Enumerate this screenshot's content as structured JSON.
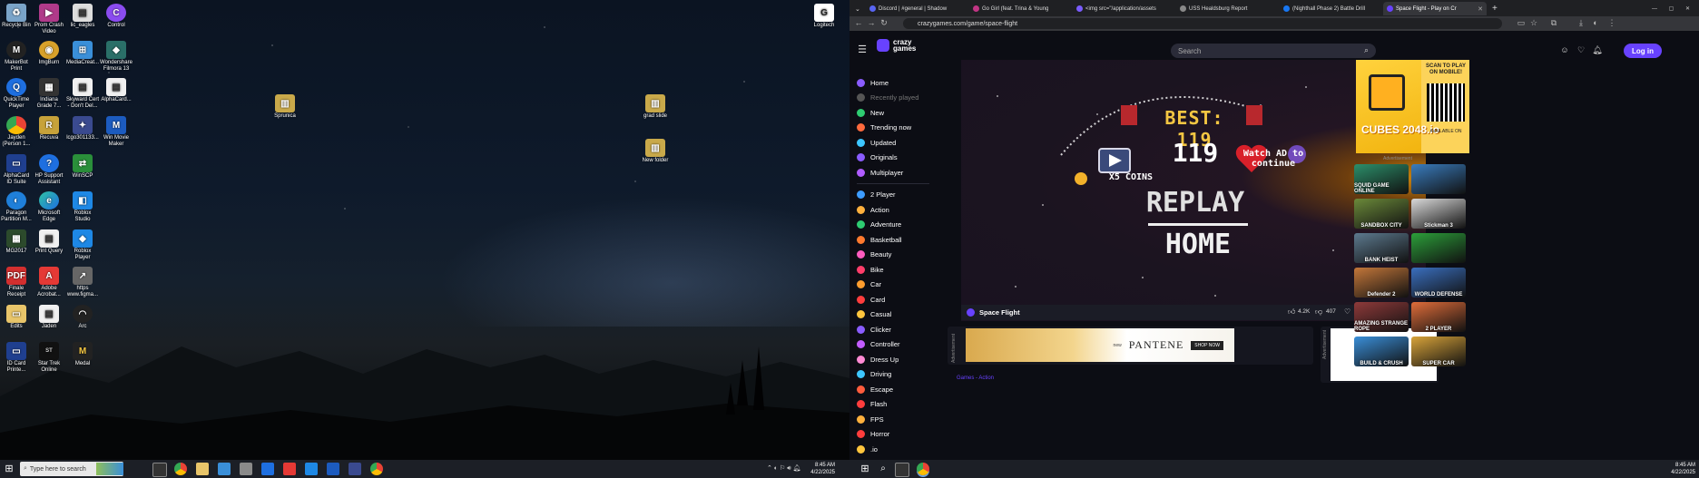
{
  "desktop": {
    "icons": [
      {
        "label": "Recycle Bin",
        "name": "recycle-bin-icon"
      },
      {
        "label": "Prom Crash Video",
        "name": "video-file-icon"
      },
      {
        "label": "lic_eagles",
        "name": "image-file-icon"
      },
      {
        "label": "Control",
        "name": "app-icon"
      },
      {
        "label": "MakerBot Print",
        "name": "makerbot-icon"
      },
      {
        "label": "ImgBurn",
        "name": "disc-icon"
      },
      {
        "label": "MediaCreat...",
        "name": "media-creation-icon"
      },
      {
        "label": "Wondershare Filmora 13",
        "name": "filmora-icon"
      },
      {
        "label": "QuickTime Player",
        "name": "quicktime-icon"
      },
      {
        "label": "Indiana Grade 7...",
        "name": "document-icon"
      },
      {
        "label": "Skyward Cert - Don't Del...",
        "name": "document-icon"
      },
      {
        "label": "AlphaCard...",
        "name": "document-icon"
      },
      {
        "label": "Jayden (Person 1...",
        "name": "chrome-profile-icon"
      },
      {
        "label": "Recuva",
        "name": "recuva-icon"
      },
      {
        "label": "lcgo301133...",
        "name": "image-file-icon"
      },
      {
        "label": "Win Movie Maker",
        "name": "movie-maker-icon"
      },
      {
        "label": "AlphaCard ID Suite",
        "name": "alphacard-icon"
      },
      {
        "label": "HP Support Assistant",
        "name": "hp-support-icon"
      },
      {
        "label": "WinSCP",
        "name": "winscp-icon"
      },
      {
        "label": "Paragon Partition M...",
        "name": "paragon-icon"
      },
      {
        "label": "Microsoft Edge",
        "name": "edge-icon"
      },
      {
        "label": "Roblox Studio",
        "name": "roblox-studio-icon"
      },
      {
        "label": "MG2017",
        "name": "app-icon"
      },
      {
        "label": "Print Query",
        "name": "document-icon"
      },
      {
        "label": "Roblox Player",
        "name": "roblox-icon"
      },
      {
        "label": "Finale Receipt",
        "name": "pdf-icon"
      },
      {
        "label": "Adobe Acrobat...",
        "name": "acrobat-icon"
      },
      {
        "label": "https www.figma...",
        "name": "shortcut-icon"
      },
      {
        "label": "Edits",
        "name": "folder-icon"
      },
      {
        "label": "Jaden",
        "name": "document-icon"
      },
      {
        "label": "Arc",
        "name": "arc-icon"
      },
      {
        "label": "ID Card Printe...",
        "name": "id-card-icon"
      },
      {
        "label": "Star Trek Online",
        "name": "star-trek-icon"
      },
      {
        "label": "Medal",
        "name": "medal-icon"
      },
      {
        "label": "Sprunica",
        "name": "archive-icon"
      },
      {
        "label": "grad slide",
        "name": "archive-icon"
      },
      {
        "label": "New folder",
        "name": "archive-icon"
      },
      {
        "label": "Logitech",
        "name": "logitech-icon"
      }
    ]
  },
  "taskbar": {
    "search_placeholder": "Type here to search",
    "time_left": "8:45 AM",
    "date_left": "4/22/2025",
    "time_right": "8:45 AM",
    "date_right": "4/22/2025"
  },
  "browser": {
    "tabs": [
      {
        "label": "Discord | #general | Shadow",
        "color": "#5865f2"
      },
      {
        "label": "Go Girl (feat. Trina & Young",
        "color": "#c13584"
      },
      {
        "label": "<img src=\"/application/assets",
        "color": "#7a5cff"
      },
      {
        "label": "USS Healdsburg Report",
        "color": "#888888"
      },
      {
        "label": "(Nighthall Phase 2) Battle Drill",
        "color": "#1877f2"
      },
      {
        "label": "Space Flight - Play on Cr",
        "color": "#6842ff"
      }
    ],
    "url": "crazygames.com/game/space-flight"
  },
  "crazygames": {
    "logo_top": "crazy",
    "logo_bottom": "games",
    "search_placeholder": "Search",
    "login_label": "Log in",
    "sidebar": [
      {
        "label": "Home",
        "color": "#8a5cff"
      },
      {
        "label": "Recently played",
        "color": "#555555",
        "dim": true
      },
      {
        "label": "New",
        "color": "#2ecc71"
      },
      {
        "label": "Trending now",
        "color": "#ff6a3d"
      },
      {
        "label": "Updated",
        "color": "#3dc6ff"
      },
      {
        "label": "Originals",
        "color": "#8a5cff"
      },
      {
        "label": "Multiplayer",
        "color": "#b05cff"
      },
      {
        "label": "2 Player",
        "color": "#3d9cff"
      },
      {
        "label": "Action",
        "color": "#ffb03d"
      },
      {
        "label": "Adventure",
        "color": "#2ecc71"
      },
      {
        "label": "Basketball",
        "color": "#ff7a2e"
      },
      {
        "label": "Beauty",
        "color": "#ff5cbf"
      },
      {
        "label": "Bike",
        "color": "#ff3d6a"
      },
      {
        "label": "Car",
        "color": "#ff9d2e"
      },
      {
        "label": "Card",
        "color": "#ff3d3d"
      },
      {
        "label": "Casual",
        "color": "#ffc53d"
      },
      {
        "label": "Clicker",
        "color": "#8a5cff"
      },
      {
        "label": "Controller",
        "color": "#c25cff"
      },
      {
        "label": "Dress Up",
        "color": "#ff8ad4"
      },
      {
        "label": "Driving",
        "color": "#3dc6ff"
      },
      {
        "label": "Escape",
        "color": "#ff5c3d"
      },
      {
        "label": "Flash",
        "color": "#ff3d3d"
      },
      {
        "label": "FPS",
        "color": "#ffb03d"
      },
      {
        "label": "Horror",
        "color": "#ff3d3d"
      },
      {
        ".io_label": "",
        "label": ".io",
        "color": "#ffc53d"
      }
    ],
    "game": {
      "best": "BEST: 119",
      "score": "119",
      "coins": "X5 COINS",
      "watch_ad": "Watch AD to continue",
      "replay": "REPLAY",
      "home": "HOME",
      "title": "Space Flight",
      "likes": "4.2K",
      "dislikes": "407"
    },
    "ad_label": "Advertisement",
    "ad_brand": "PANTENE",
    "ad_new": "new",
    "ad_cta": "SHOP NOW",
    "promo": {
      "game": "CUBES 2048.io",
      "scan": "SCAN TO PLAY ON MOBILE!",
      "available": "AVAILABLE ON"
    },
    "thumbs": [
      {
        "label": "SQUID GAME ONLINE",
        "color": "#2c8f6a"
      },
      {
        "label": "",
        "color": "#3a7dbf"
      },
      {
        "label": "SANDBOX CITY",
        "color": "#6b8a3a"
      },
      {
        "label": "Stickman 3",
        "color": "#d9d9d9"
      },
      {
        "label": "BANK HEIST",
        "color": "#5d7a8f"
      },
      {
        "label": "",
        "color": "#2c9f3a"
      },
      {
        "label": "Defender 2",
        "color": "#c4773a"
      },
      {
        "label": "WORLD DEFENSE",
        "color": "#3a6fbf"
      },
      {
        "label": "AMAZING STRANGE ROPE",
        "color": "#8f3a3a"
      },
      {
        "label": "2 PLAYER",
        "color": "#e06d3a"
      },
      {
        "label": "BUILD & CRUSH",
        "color": "#3a8fd9"
      },
      {
        "label": "SUPER CAR",
        "color": "#d9a43a"
      }
    ],
    "section_title": "Games - Action"
  }
}
